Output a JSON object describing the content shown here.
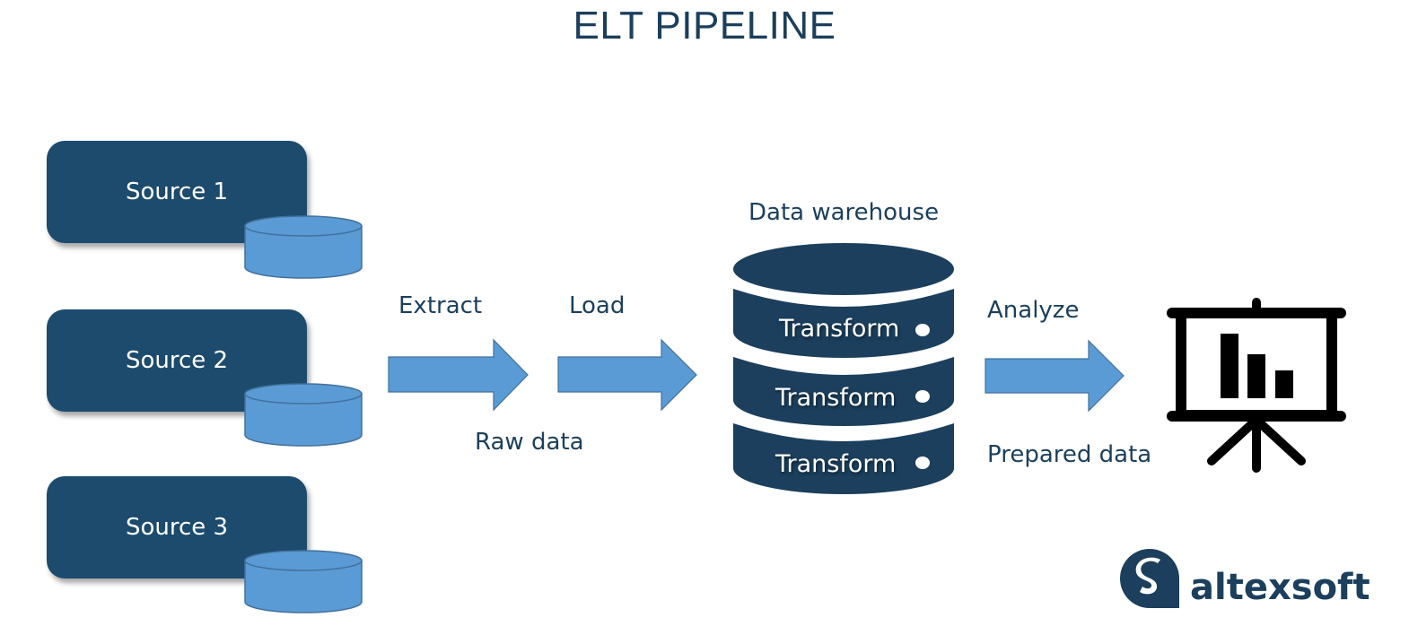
{
  "title": "ELT PIPELINE",
  "sources": [
    {
      "label": "Source 1"
    },
    {
      "label": "Source 2"
    },
    {
      "label": "Source 3"
    }
  ],
  "steps": {
    "extract": "Extract",
    "load": "Load",
    "raw_data": "Raw data",
    "analyze": "Analyze",
    "prepared_data": "Prepared data"
  },
  "warehouse": {
    "label": "Data warehouse",
    "layers": [
      "Transform",
      "Transform",
      "Transform"
    ]
  },
  "icons": {
    "database": "cylinder-icon",
    "arrow": "arrow-right-icon",
    "presentation": "presentation-board-chart-icon"
  },
  "brand": {
    "name": "altexsoft"
  },
  "colors": {
    "primary_dark": "#1c4b6d",
    "title": "#1b3f5c",
    "accent_blue": "#5b9bd5",
    "warehouse": "#1b3f5c"
  }
}
